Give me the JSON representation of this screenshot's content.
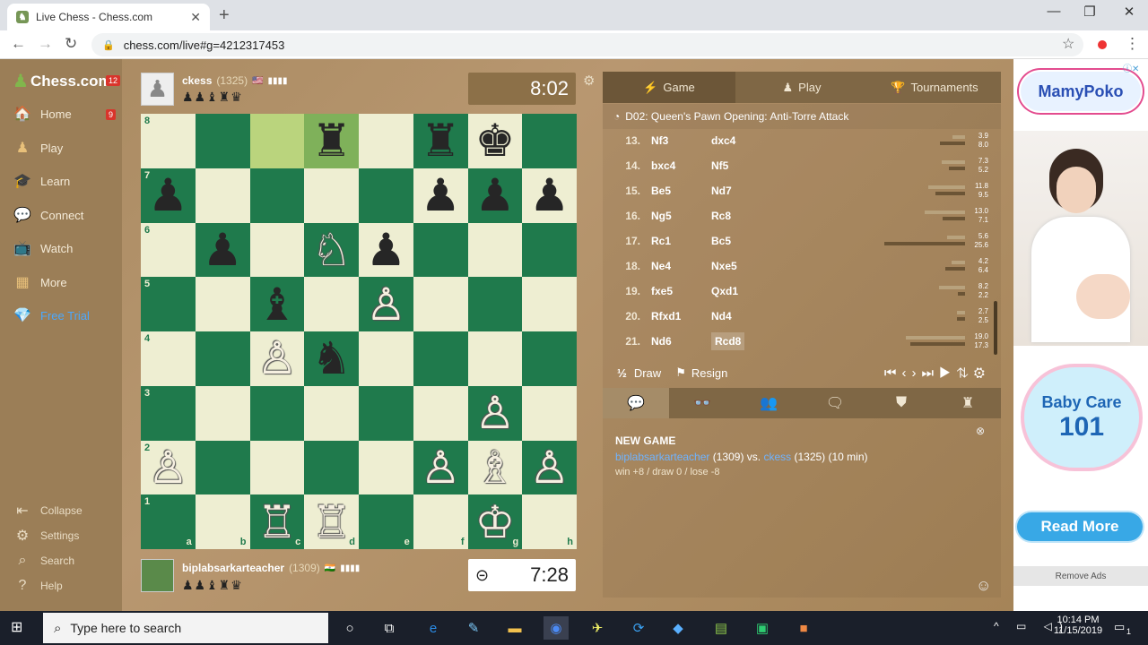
{
  "browser": {
    "tab_title": "Live Chess - Chess.com",
    "url": "chess.com/live#g=4212317453"
  },
  "sidebar": {
    "logo": "Chess.com",
    "logo_badge": "12",
    "items": [
      {
        "label": "Home",
        "badge": "9",
        "icon": "home-icon"
      },
      {
        "label": "Play",
        "icon": "pawn-icon"
      },
      {
        "label": "Learn",
        "icon": "cap-icon"
      },
      {
        "label": "Connect",
        "icon": "chat-icon"
      },
      {
        "label": "Watch",
        "icon": "tv-icon"
      },
      {
        "label": "More",
        "icon": "grid-icon"
      },
      {
        "label": "Free Trial",
        "icon": "diamond-icon"
      }
    ],
    "bottom": [
      {
        "label": "Collapse"
      },
      {
        "label": "Settings"
      },
      {
        "label": "Search"
      },
      {
        "label": "Help"
      }
    ]
  },
  "top_player": {
    "name": "ckess",
    "rating": "(1325)",
    "captured": "♟♟♝♜♛",
    "clock": "8:02"
  },
  "bottom_player": {
    "name": "biplabsarkarteacher",
    "rating": "(1309)",
    "captured": "♟♟♝♜♛",
    "clock": "7:28"
  },
  "board": {
    "files": [
      "a",
      "b",
      "c",
      "d",
      "e",
      "f",
      "g",
      "h"
    ],
    "ranks": [
      "8",
      "7",
      "6",
      "5",
      "4",
      "3",
      "2",
      "1"
    ],
    "pieces": [
      [
        "",
        "",
        "",
        "♜",
        "",
        "♜",
        "♚",
        ""
      ],
      [
        "♟",
        "",
        "",
        "",
        "",
        "♟",
        "♟",
        "♟"
      ],
      [
        "",
        "♟",
        "",
        "♘",
        "♟",
        "",
        "",
        ""
      ],
      [
        "",
        "",
        "♝",
        "",
        "♙",
        "",
        "",
        ""
      ],
      [
        "",
        "",
        "♙",
        "♞",
        "",
        "",
        "",
        ""
      ],
      [
        "",
        "",
        "",
        "",
        "",
        "",
        "♙",
        ""
      ],
      [
        "♙",
        "",
        "",
        "",
        "",
        "♙",
        "♗",
        "♙"
      ],
      [
        "",
        "",
        "♖",
        "♖",
        "",
        "",
        "♔",
        ""
      ]
    ]
  },
  "panel": {
    "tabs": [
      "Game",
      "Play",
      "Tournaments"
    ],
    "opening": "D02: Queen's Pawn Opening: Anti-Torre Attack",
    "moves": [
      {
        "n": "13.",
        "w": "Nf3",
        "b": "dxc4",
        "e1": "3.9",
        "e2": "8.0"
      },
      {
        "n": "14.",
        "w": "bxc4",
        "b": "Nf5",
        "e1": "7.3",
        "e2": "5.2"
      },
      {
        "n": "15.",
        "w": "Be5",
        "b": "Nd7",
        "e1": "11.8",
        "e2": "9.5"
      },
      {
        "n": "16.",
        "w": "Ng5",
        "b": "Rc8",
        "e1": "13.0",
        "e2": "7.1"
      },
      {
        "n": "17.",
        "w": "Rc1",
        "b": "Bc5",
        "e1": "5.6",
        "e2": "25.6"
      },
      {
        "n": "18.",
        "w": "Ne4",
        "b": "Nxe5",
        "e1": "4.2",
        "e2": "6.4"
      },
      {
        "n": "19.",
        "w": "fxe5",
        "b": "Qxd1",
        "e1": "8.2",
        "e2": "2.2"
      },
      {
        "n": "20.",
        "w": "Rfxd1",
        "b": "Nd4",
        "e1": "2.7",
        "e2": "2.5"
      },
      {
        "n": "21.",
        "w": "Nd6",
        "b": "Rcd8",
        "e1": "19.0",
        "e2": "17.3"
      }
    ],
    "draw_label": "Draw",
    "draw_prefix": "½",
    "resign_label": "Resign",
    "chat_title": "NEW GAME",
    "chat_player1": "biplabsarkarteacher",
    "chat_r1": "(1309) vs.",
    "chat_player2": "ckess",
    "chat_r2": "(1325) (10 min)",
    "chat_stats": "win +8 / draw 0 / lose -8"
  },
  "ad": {
    "brand": "MamyPoko",
    "headline1": "Baby Care",
    "headline2": "101",
    "button": "Read More",
    "remove": "Remove Ads"
  },
  "taskbar": {
    "search_placeholder": "Type here to search",
    "time": "10:14 PM",
    "date": "11/15/2019",
    "notif": "1"
  }
}
